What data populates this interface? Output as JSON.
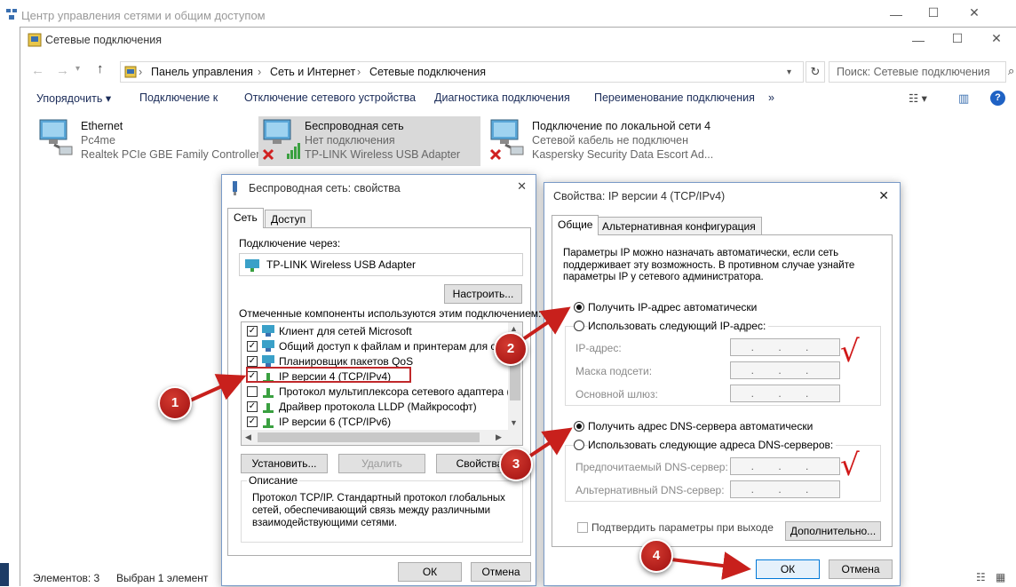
{
  "bg_window": {
    "title": "Центр управления сетями и общим доступом"
  },
  "explorer": {
    "title": "Сетевые подключения",
    "breadcrumb": [
      "Панель управления",
      "Сеть и Интернет",
      "Сетевые подключения"
    ],
    "search_placeholder": "Поиск: Сетевые подключения",
    "commands": [
      "Упорядочить ▾",
      "Подключение к",
      "Отключение сетевого устройства",
      "Диагностика подключения",
      "Переименование подключения",
      "»"
    ],
    "adapters": [
      {
        "name": "Ethernet",
        "status": "Pc4me",
        "device": "Realtek PCIe GBE Family Controller"
      },
      {
        "name": "Беспроводная сеть",
        "status": "Нет подключения",
        "device": "TP-LINK Wireless USB Adapter"
      },
      {
        "name": "Подключение по локальной сети 4",
        "status": "Сетевой кабель не подключен",
        "device": "Kaspersky Security Data Escort Ad..."
      }
    ],
    "status_items": "Элементов: 3",
    "status_selected": "Выбран 1 элемент"
  },
  "props_dialog": {
    "title": "Беспроводная сеть: свойства",
    "tabs": [
      "Сеть",
      "Доступ"
    ],
    "connect_via_label": "Подключение через:",
    "adapter_name": "TP-LINK Wireless USB Adapter",
    "configure_button": "Настроить...",
    "components_label": "Отмеченные компоненты используются этим подключением:",
    "components": [
      {
        "label": "Клиент для сетей Microsoft",
        "checked": true
      },
      {
        "label": "Общий доступ к файлам и принтерам для сетей",
        "checked": true
      },
      {
        "label": "Планировщик пакетов QoS",
        "checked": true
      },
      {
        "label": "IP версии 4 (TCP/IPv4)",
        "checked": true
      },
      {
        "label": "Протокол мультиплексора сетевого адаптера (Май",
        "checked": false
      },
      {
        "label": "Драйвер протокола LLDP (Майкрософт)",
        "checked": true
      },
      {
        "label": "IP версии 6 (TCP/IPv6)",
        "checked": true
      }
    ],
    "install_button": "Установить...",
    "remove_button": "Удалить",
    "properties_button": "Свойства",
    "description_label": "Описание",
    "description_text": "Протокол TCP/IP. Стандартный протокол глобальных сетей, обеспечивающий связь между различными взаимодействующими сетями.",
    "ok_button": "ОК",
    "cancel_button": "Отмена"
  },
  "ipv4_dialog": {
    "title": "Свойства: IP версии 4 (TCP/IPv4)",
    "tabs": [
      "Общие",
      "Альтернативная конфигурация"
    ],
    "intro_text": "Параметры IP можно назначать автоматически, если сеть поддерживает эту возможность. В противном случае узнайте параметры IP у сетевого администратора.",
    "ip_auto": "Получить IP-адрес автоматически",
    "ip_manual": "Использовать следующий IP-адрес:",
    "ip_address_label": "IP-адрес:",
    "subnet_label": "Маска подсети:",
    "gateway_label": "Основной шлюз:",
    "ip_placeholder": ".   .   .",
    "dns_auto": "Получить адрес DNS-сервера автоматически",
    "dns_manual": "Использовать следующие адреса DNS-серверов:",
    "dns_preferred_label": "Предпочитаемый DNS-сервер:",
    "dns_alternate_label": "Альтернативный DNS-сервер:",
    "validate_label": "Подтвердить параметры при выходе",
    "advanced_button": "Дополнительно...",
    "ok_button": "ОК",
    "cancel_button": "Отмена"
  },
  "markers": [
    "1",
    "2",
    "3",
    "4"
  ],
  "checkmarks": [
    "√",
    "√"
  ],
  "colors": {
    "marker_red": "#b81c1c",
    "arrow_red": "#c8201c",
    "highlight_box": "#c0282a",
    "accent_blue": "#0078d7"
  }
}
